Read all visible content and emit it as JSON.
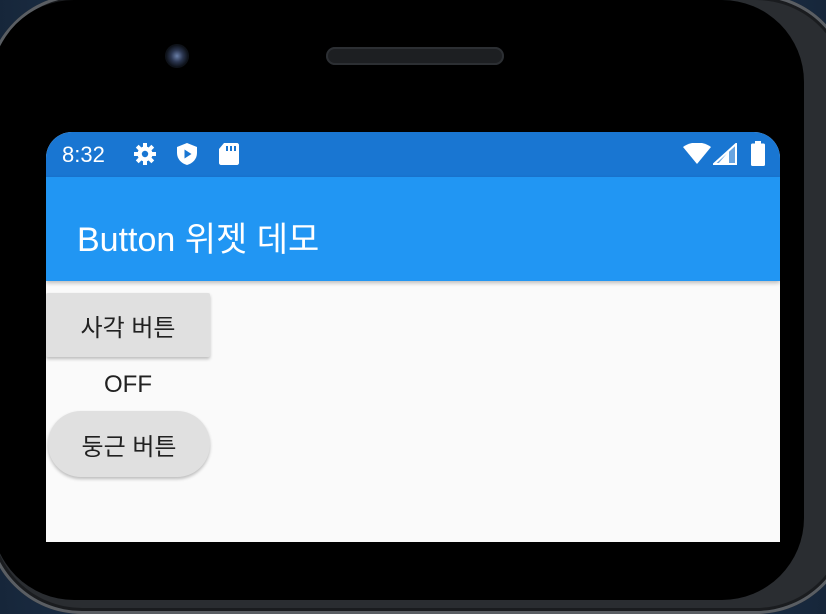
{
  "status_bar": {
    "time": "8:32",
    "icons": [
      "gear-icon",
      "shield-play-icon",
      "sd-card-icon",
      "wifi-icon",
      "cell-signal-icon",
      "battery-icon"
    ]
  },
  "app_bar": {
    "title": "Button 위젯 데모"
  },
  "content": {
    "rect_button_label": "사각 버튼",
    "state_text": "OFF",
    "round_button_label": "둥근 버튼"
  },
  "colors": {
    "status_bar": "#1976d2",
    "app_bar": "#2196f3",
    "background": "#fafafa",
    "button": "#e0e0e0"
  }
}
